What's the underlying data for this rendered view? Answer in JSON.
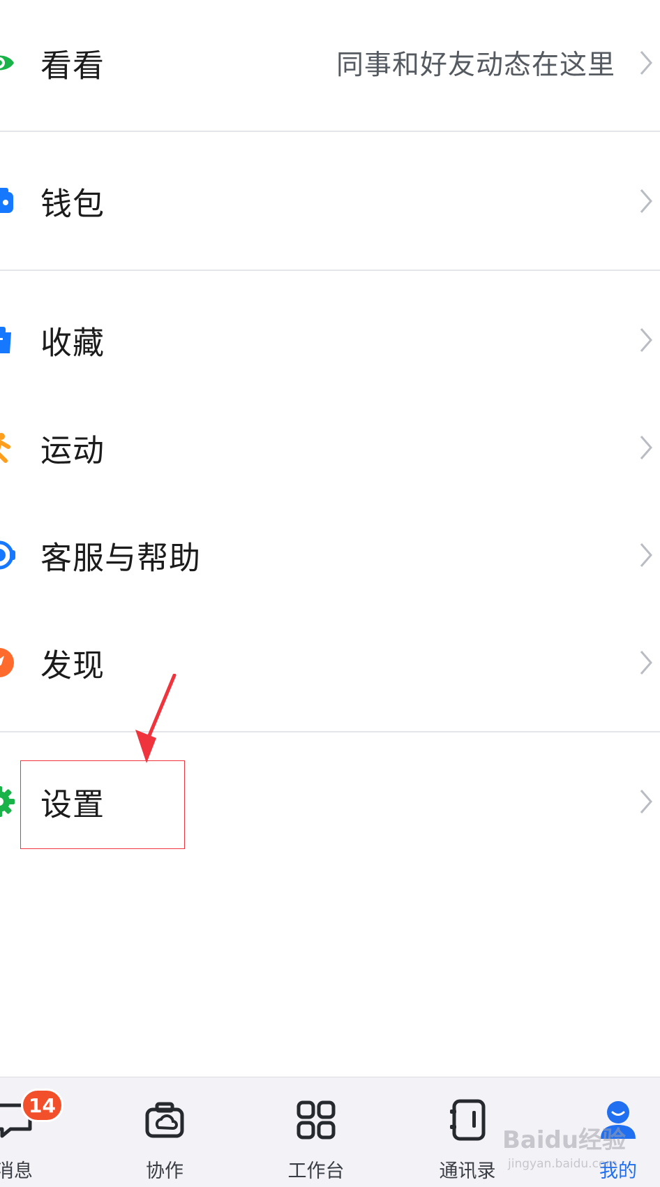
{
  "menu": {
    "kankan": {
      "label": "看看",
      "subtitle": "同事和好友动态在这里"
    },
    "wallet": {
      "label": "钱包"
    },
    "favorites": {
      "label": "收藏"
    },
    "sport": {
      "label": "运动"
    },
    "support": {
      "label": "客服与帮助"
    },
    "discover": {
      "label": "发现"
    },
    "settings": {
      "label": "设置"
    }
  },
  "icons": {
    "kankan": "eye-icon",
    "wallet": "wallet-icon",
    "favorites": "favorites-icon",
    "sport": "sport-icon",
    "support": "headset-icon",
    "discover": "compass-icon",
    "settings": "gear-icon",
    "chevron": "chevron-right-icon"
  },
  "tabbar": {
    "messages": {
      "label": "消息",
      "badge": "14"
    },
    "collab": {
      "label": "协作"
    },
    "workbench": {
      "label": "工作台"
    },
    "contacts": {
      "label": "通讯录"
    },
    "me": {
      "label": "我的"
    }
  },
  "watermark": {
    "title": "Baidu经验",
    "url": "jingyan.baidu.com"
  },
  "colors": {
    "accent": "#1f6ff0",
    "kankan": "#19b34a",
    "wallet": "#1677ff",
    "favorites": "#1677ff",
    "sport": "#ff9d1c",
    "support": "#1677ff",
    "discover": "#ff6b2c",
    "settings": "#19b34a",
    "badge": "#f2502a",
    "annotation": "#f0343e"
  }
}
